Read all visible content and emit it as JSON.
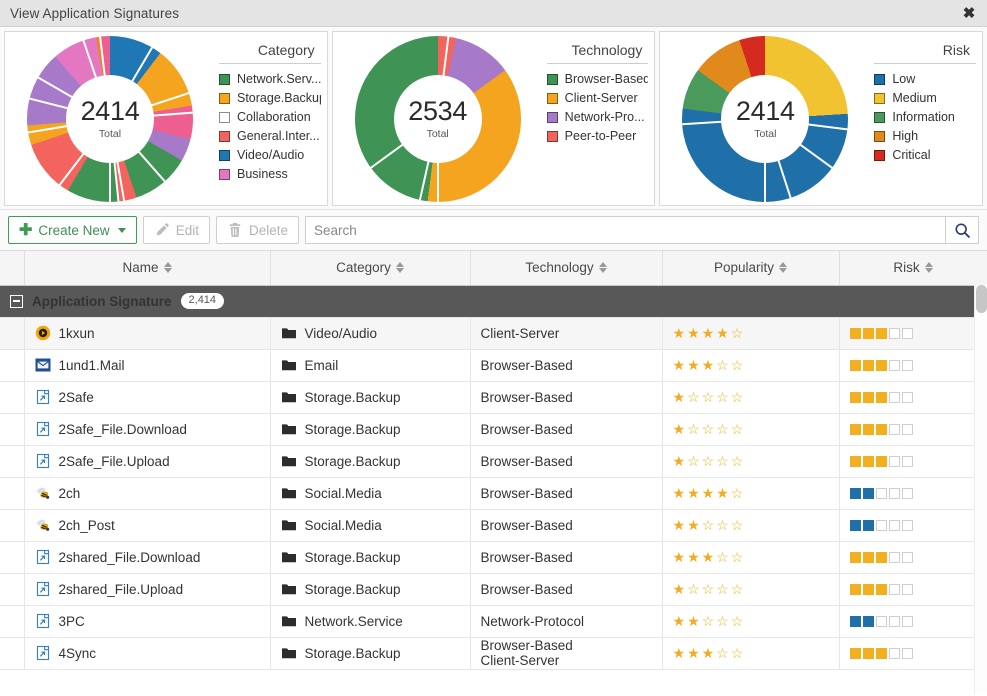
{
  "window": {
    "title": "View Application Signatures",
    "close_icon": "close-icon"
  },
  "charts": [
    {
      "legend_title": "Category",
      "total": "2414",
      "total_label": "Total",
      "legend": [
        {
          "label": "Network.Serv...",
          "color": "#3f9455"
        },
        {
          "label": "Storage.Backup",
          "color": "#f4a41e"
        },
        {
          "label": "Collaboration",
          "color": "#a israel"
        },
        {
          "label": "General.Inter...",
          "color": "#f4645f"
        },
        {
          "label": "Video/Audio",
          "color": "#1f77b4"
        },
        {
          "label": "Business",
          "color": "#e377c2"
        }
      ]
    },
    {
      "legend_title": "Technology",
      "total": "2534",
      "total_label": "Total",
      "legend": [
        {
          "label": "Browser-Based",
          "color": "#3f9455"
        },
        {
          "label": "Client-Server",
          "color": "#f4a41e"
        },
        {
          "label": "Network-Pro...",
          "color": "#a779c9"
        },
        {
          "label": "Peer-to-Peer",
          "color": "#f4645f"
        }
      ]
    },
    {
      "legend_title": "Risk",
      "total": "2414",
      "total_label": "Total",
      "legend": [
        {
          "label": "Low",
          "color": "#1f6fa8"
        },
        {
          "label": "Medium",
          "color": "#f2c330"
        },
        {
          "label": "Information",
          "color": "#4a9a5c"
        },
        {
          "label": "High",
          "color": "#e08a1e"
        },
        {
          "label": "Critical",
          "color": "#d42a20"
        }
      ]
    }
  ],
  "chart_data": [
    {
      "type": "pie",
      "title": "Category",
      "center_value": 2414,
      "center_label": "Total",
      "legend_position": "right",
      "categories": [
        "Video/Audio",
        "Storage.Backup",
        "General.Inter...",
        "Collaboration",
        "Network.Serv...",
        "General.Inter...",
        "Network.Serv...",
        "General.Inter...",
        "Storage.Backup",
        "Collaboration",
        "Business",
        "General.Inter...",
        "Business"
      ],
      "values": [
        9.5,
        11.0,
        6.0,
        4.0,
        10.5,
        3.0,
        9.5,
        10.5,
        3.5,
        13.5,
        8.0,
        1.0,
        1.5
      ],
      "colors": [
        "#1f77b4",
        "#f4a41e",
        "#ec5f90",
        "#a779c9",
        "#3f9455",
        "#f4645f",
        "#3f9455",
        "#f4645f",
        "#f4a41e",
        "#a779c9",
        "#e377c2",
        "#f08030",
        "#ec5f90"
      ]
    },
    {
      "type": "pie",
      "title": "Technology",
      "center_value": 2534,
      "center_label": "Total",
      "legend_position": "right",
      "categories": [
        "Peer-to-Peer",
        "Network-Pro...",
        "Client-Server",
        "Browser-Based"
      ],
      "values": [
        3.5,
        11.5,
        37.0,
        48.0
      ],
      "colors": [
        "#f4645f",
        "#a779c9",
        "#f4a41e",
        "#3f9455"
      ]
    },
    {
      "type": "pie",
      "title": "Risk",
      "center_value": 2414,
      "center_label": "Total",
      "legend_position": "right",
      "categories": [
        "Medium",
        "Low",
        "Information",
        "High",
        "Critical"
      ],
      "values": [
        24.0,
        53.0,
        8.0,
        10.0,
        5.0
      ],
      "colors": [
        "#f2c330",
        "#1f6fa8",
        "#4a9a5c",
        "#e08a1e",
        "#d42a20"
      ]
    }
  ],
  "toolbar": {
    "create_new_label": "Create New",
    "edit_label": "Edit",
    "delete_label": "Delete",
    "search_placeholder": "Search",
    "search_value": "",
    "search_icon": "search-icon"
  },
  "table": {
    "columns": [
      "Name",
      "Category",
      "Technology",
      "Popularity",
      "Risk"
    ],
    "group": {
      "label": "Application Signature",
      "count": "2,414"
    },
    "rows": [
      {
        "icon": "media-play-icon",
        "name": "1kxun",
        "category": "Video/Audio",
        "technology": "Client-Server",
        "popularity": 4,
        "risk_level": 3,
        "risk_color": "#f2b01e"
      },
      {
        "icon": "mail-icon",
        "name": "1und1.Mail",
        "category": "Email",
        "technology": "Browser-Based",
        "popularity": 3,
        "risk_level": 3,
        "risk_color": "#f2b01e"
      },
      {
        "icon": "page-link-icon",
        "name": "2Safe",
        "category": "Storage.Backup",
        "technology": "Browser-Based",
        "popularity": 1,
        "risk_level": 3,
        "risk_color": "#f2b01e"
      },
      {
        "icon": "page-link-icon",
        "name": "2Safe_File.Download",
        "category": "Storage.Backup",
        "technology": "Browser-Based",
        "popularity": 1,
        "risk_level": 3,
        "risk_color": "#f2b01e"
      },
      {
        "icon": "page-link-icon",
        "name": "2Safe_File.Upload",
        "category": "Storage.Backup",
        "technology": "Browser-Based",
        "popularity": 1,
        "risk_level": 3,
        "risk_color": "#f2b01e"
      },
      {
        "icon": "bee-icon",
        "name": "2ch",
        "category": "Social.Media",
        "technology": "Browser-Based",
        "popularity": 4,
        "risk_level": 2,
        "risk_color": "#1f6fa8"
      },
      {
        "icon": "bee-icon",
        "name": "2ch_Post",
        "category": "Social.Media",
        "technology": "Browser-Based",
        "popularity": 2,
        "risk_level": 2,
        "risk_color": "#1f6fa8"
      },
      {
        "icon": "page-link-icon",
        "name": "2shared_File.Download",
        "category": "Storage.Backup",
        "technology": "Browser-Based",
        "popularity": 3,
        "risk_level": 3,
        "risk_color": "#f2b01e"
      },
      {
        "icon": "page-link-icon",
        "name": "2shared_File.Upload",
        "category": "Storage.Backup",
        "technology": "Browser-Based",
        "popularity": 1,
        "risk_level": 3,
        "risk_color": "#f2b01e"
      },
      {
        "icon": "page-link-icon",
        "name": "3PC",
        "category": "Network.Service",
        "technology": "Network-Protocol",
        "popularity": 2,
        "risk_level": 2,
        "risk_color": "#1f6fa8"
      },
      {
        "icon": "page-link-icon",
        "name": "4Sync",
        "category": "Storage.Backup",
        "technology": "Browser-Based\nClient-Server",
        "popularity": 3,
        "risk_level": 3,
        "risk_color": "#f2b01e"
      }
    ]
  }
}
